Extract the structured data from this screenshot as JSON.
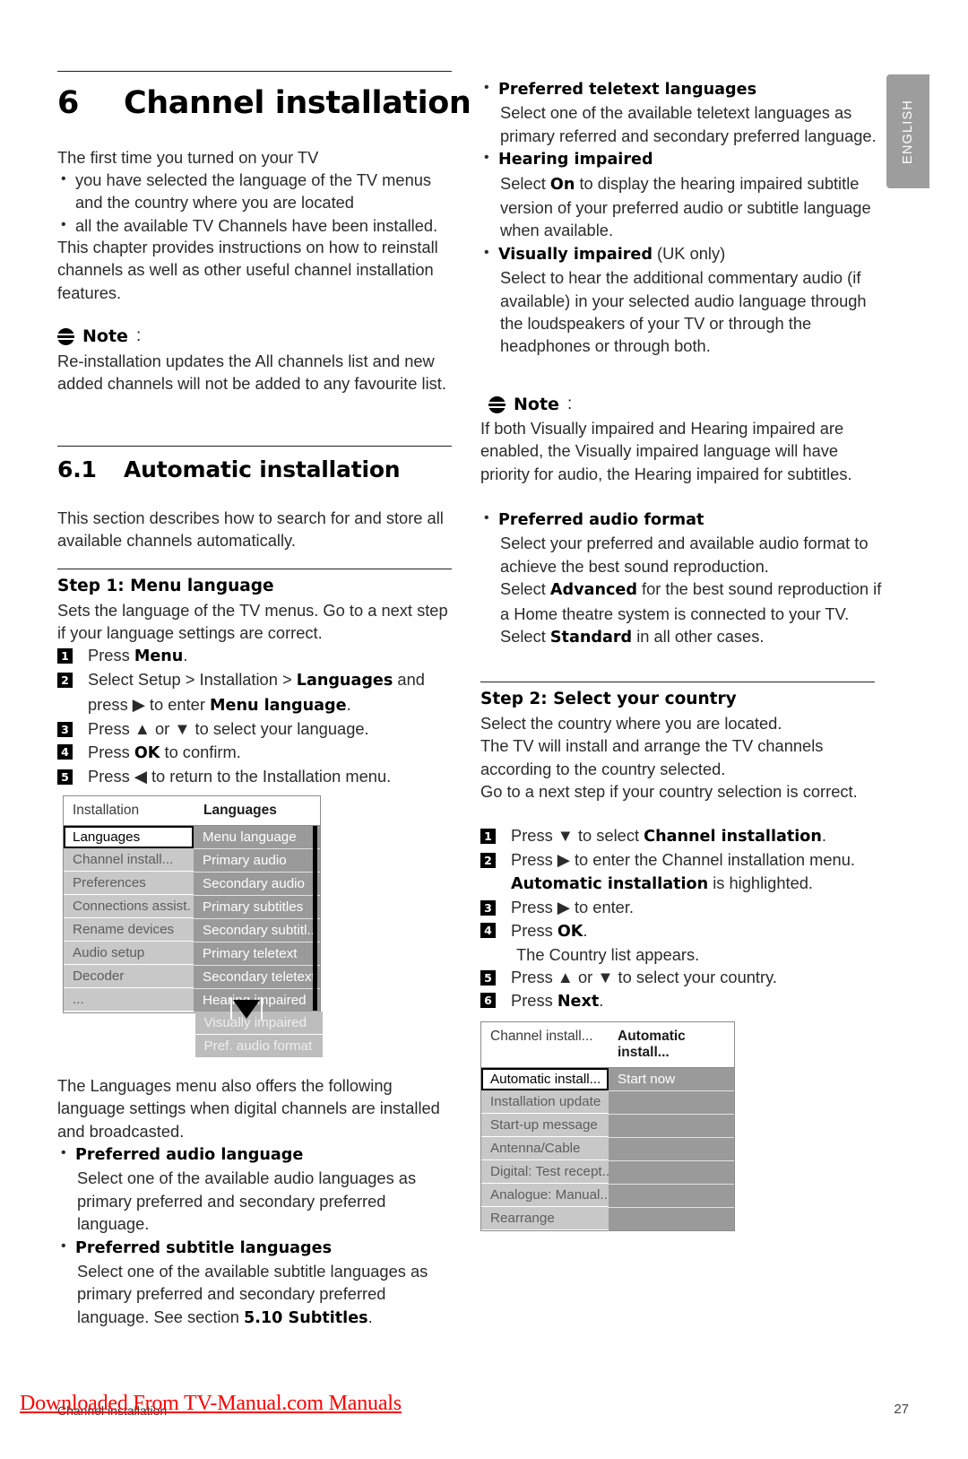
{
  "sidebar_tab": {
    "label": "ENGLISH"
  },
  "left_column": {
    "chapter": {
      "number": "6",
      "title": "Channel installation"
    },
    "intro_lead": "The first time you turned on your TV",
    "intro_bullets": [
      "you have selected the language of the TV menus and the country where you are located",
      "all the available TV Channels have been installed."
    ],
    "intro_after": "This chapter provides instructions on how to reinstall channels as well as other useful channel installation features.",
    "note1": {
      "label": "Note",
      "colon": ":",
      "body": "Re-installation updates the All channels list and new added channels will not be added to any favourite list."
    },
    "section": {
      "number": "6.1",
      "title": "Automatic installation"
    },
    "section_intro": "This section describes how to search for and store all available channels automatically.",
    "step1": {
      "heading": "Step 1: Menu language",
      "intro": "Sets the language of the TV menus. Go to a next step if your language settings are correct.",
      "items": [
        {
          "num": "1",
          "pre": "Press ",
          "bold": "Menu",
          "post": "."
        },
        {
          "num": "2",
          "pre": "Select Setup > Installation > ",
          "bold": "Languages",
          "post": " and"
        },
        {
          "num": "2b",
          "cont": true,
          "pre": "press ▶ to enter ",
          "bold": "Menu language",
          "post": "."
        },
        {
          "num": "3",
          "pre": "Press ▲ or ▼ to select your language.",
          "bold": "",
          "post": ""
        },
        {
          "num": "4",
          "pre": "Press ",
          "bold": "OK",
          "post": " to confirm."
        },
        {
          "num": "5",
          "pre": "Press ◀ to return to the Installation menu.",
          "bold": "",
          "post": ""
        }
      ]
    },
    "menu1": {
      "header_left": "Installation",
      "header_right": "Languages",
      "left_items": [
        "Languages",
        "Channel install...",
        "Preferences",
        "Connections assist.",
        "Rename devices",
        "Audio setup",
        "Decoder",
        "..."
      ],
      "left_selected_index": 0,
      "right_items": [
        "Menu language",
        "Primary audio",
        "Secondary audio",
        "Primary subtitles",
        "Secondary subtitl..",
        "Primary teletext",
        "Secondary teletext",
        "Hearing impaired",
        "Visually impaired",
        "Pref. audio format"
      ],
      "right_dim_from_index": 8
    },
    "after_menu": "The Languages menu also offers the following language settings when digital channels are installed and broadcasted.",
    "lang_bullets": [
      {
        "term": "Preferred audio language",
        "desc": "Select one of the available audio languages as primary preferred and secondary preferred language."
      },
      {
        "term": "Preferred subtitle languages",
        "desc_pre": "Select one of the available subtitle languages as primary preferred and secondary preferred language. See section ",
        "desc_bold": "5.10 Subtitles",
        "desc_post": "."
      }
    ]
  },
  "right_column": {
    "lang_bullets": [
      {
        "term": "Preferred teletext languages",
        "desc": "Select one of the available teletext languages as primary referred and secondary preferred language."
      },
      {
        "term": "Hearing impaired",
        "desc_pre": "Select ",
        "desc_bold": "On",
        "desc_post": " to display the hearing impaired subtitle version of your preferred audio or subtitle language when available."
      },
      {
        "term": "Visually impaired",
        "term_suffix": " (UK only)",
        "desc": "Select to hear the additional commentary audio (if available) in your selected audio language through the loudspeakers of your TV or through the headphones or through both."
      }
    ],
    "note2": {
      "label": "Note",
      "colon": ":",
      "body": "If both Visually impaired and Hearing impaired are enabled, the Visually impaired language will have priority for audio, the Hearing impaired for subtitles."
    },
    "audio_format": {
      "term": "Preferred audio format",
      "line1": "Select your preferred and available audio format to achieve the best sound reproduction.",
      "line2_pre": "Select ",
      "line2_bold": "Advanced",
      "line2_mid": " for the best sound reproduction if a Home theatre system is connected to your TV. Select ",
      "line2_bold2": "Standard",
      "line2_post": " in all other cases."
    },
    "step2": {
      "heading": "Step 2:  Select your country",
      "intro": "Select the country where you are located.\nThe TV will install and arrange the TV channels according to the country selected.\nGo to a next step if your country selection is correct.",
      "items": [
        {
          "num": "1",
          "pre": "Press ▼ to select ",
          "bold": "Channel installation",
          "post": "."
        },
        {
          "num": "2",
          "pre": "Press ▶ to enter the Channel installation menu.",
          "bold": "",
          "post": ""
        },
        {
          "num": "2b",
          "cont": true,
          "pre": "",
          "bold": "Automatic installation",
          "post": " is highlighted."
        },
        {
          "num": "3",
          "pre": "Press ▶ to enter.",
          "bold": "",
          "post": ""
        },
        {
          "num": "4",
          "pre": "Press ",
          "bold": "OK",
          "post": "."
        },
        {
          "num": "4b",
          "cont": true,
          "pre": "The Country list appears.",
          "bold": "",
          "post": ""
        },
        {
          "num": "5",
          "pre": "Press ▲ or ▼ to select your country.",
          "bold": "",
          "post": ""
        },
        {
          "num": "6",
          "pre": "Press ",
          "bold": "Next",
          "post": "."
        }
      ]
    },
    "menu2": {
      "header_left": "Channel install...",
      "header_right": "Automatic install...",
      "left_items": [
        "Automatic install...",
        "Installation update",
        "Start-up message",
        "Antenna/Cable",
        "Digital: Test recept...",
        "Analogue: Manual...",
        "Rearrange"
      ],
      "left_selected_index": 0,
      "right_items": [
        "Start now",
        "",
        "",
        "",
        "",
        "",
        ""
      ]
    }
  },
  "footer": {
    "chapter_label": "Channel installation",
    "watermark": "Downloaded From TV-Manual.com Manuals",
    "page_number": "27"
  }
}
